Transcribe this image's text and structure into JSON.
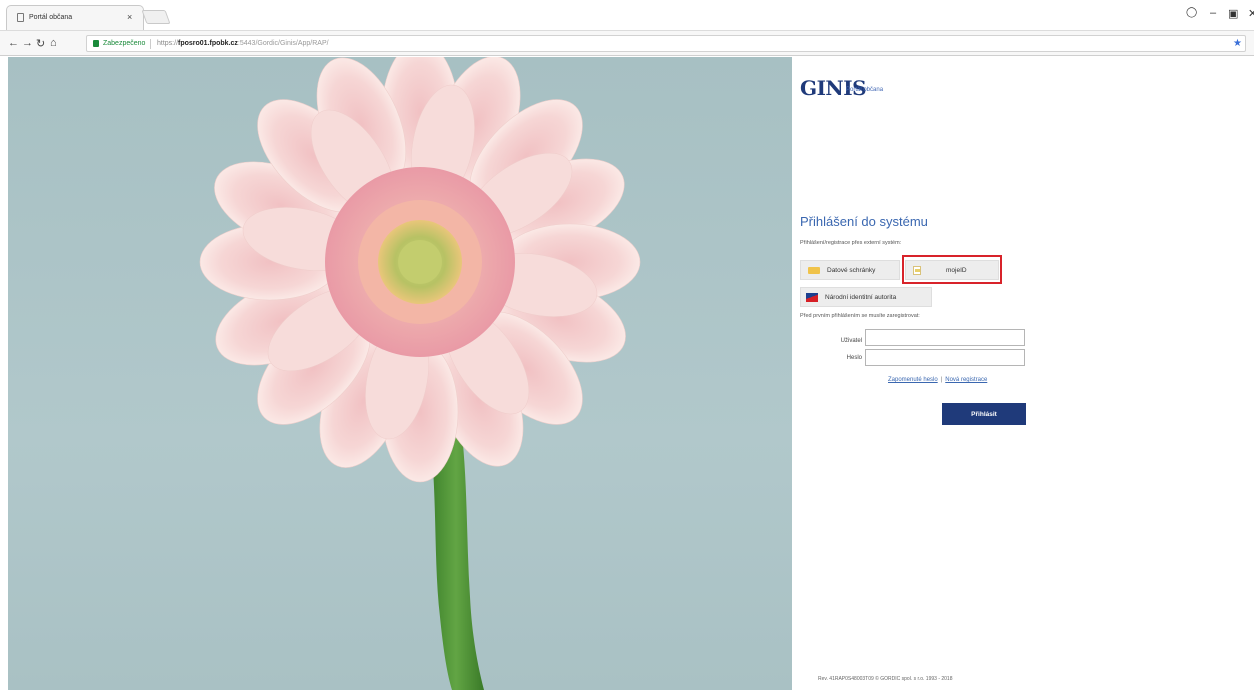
{
  "browser": {
    "tab_title": "Portál občana",
    "tab_close": "×",
    "secure_label": "Zabezpečeno",
    "url_protocol": "https://",
    "url_host": "fposro01.fpobk.cz",
    "url_path": ":5443/Gordic/Ginis/App/RAP/",
    "icons": [
      "page-icon",
      "back-arrow-icon",
      "forward-arrow-icon",
      "reload-icon",
      "home-icon",
      "lock-icon",
      "star-icon",
      "user-icon",
      "minimize-icon",
      "maximize-icon",
      "close-icon"
    ]
  },
  "header": {
    "logo": "GINIS",
    "logo_sub": "Portál občana"
  },
  "login": {
    "heading": "Přihlášení do systému",
    "external_label": "Přihlášení/registrace přes externí systém:",
    "btn_datove_schranky": "Datové schránky",
    "btn_mojeid": "mojeID",
    "btn_nia": "Národní identitní autorita",
    "pre_register_note": "Před prvním přihlášením se musíte zaregistrovat:",
    "user_label": "Uživatel",
    "password_label": "Heslo",
    "user_value": "",
    "password_value": "",
    "forgot_link": "Zapomenuté heslo",
    "separator": "|",
    "register_link": "Nová registrace",
    "submit_label": "Přihlásit",
    "highlight_color": "#d8232a"
  },
  "footer": {
    "text": "Rev. 41RAP0S48003T09 © GORDIC spol. s r.o. 1993 - 2018"
  },
  "colors": {
    "brand_dark": "#1f3a7a",
    "link_blue": "#3a67b0",
    "photo_background": "#a7c0c3"
  }
}
